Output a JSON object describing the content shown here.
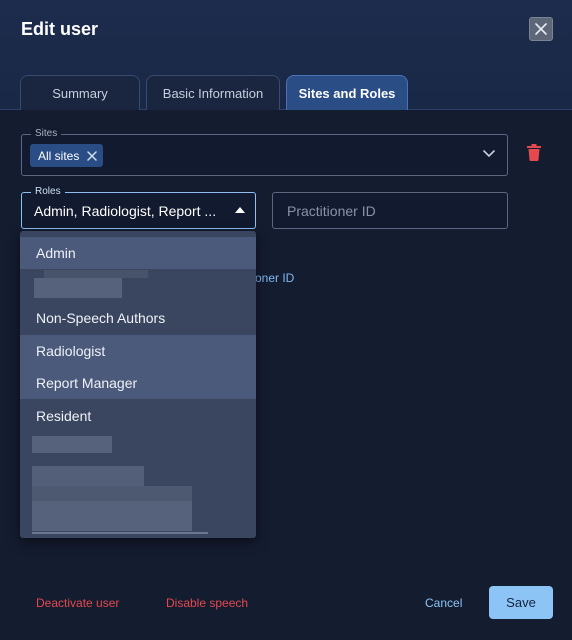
{
  "dialog": {
    "title": "Edit user"
  },
  "tabs": [
    {
      "label": "Summary",
      "active": false
    },
    {
      "label": "Basic Information",
      "active": false
    },
    {
      "label": "Sites and Roles",
      "active": true
    }
  ],
  "sites": {
    "legend": "Sites",
    "chip_label": "All sites"
  },
  "roles": {
    "legend": "Roles",
    "value": "Admin, Radiologist, Report ...",
    "options": [
      {
        "label": "Admin",
        "selected": true
      },
      {
        "label": "",
        "selected": false,
        "redacted": true
      },
      {
        "label": "Non-Speech Authors",
        "selected": false
      },
      {
        "label": "Radiologist",
        "selected": true
      },
      {
        "label": "Report Manager",
        "selected": true
      },
      {
        "label": "Resident",
        "selected": false
      }
    ]
  },
  "practitioner": {
    "placeholder": "Practitioner ID",
    "link_partial": "oner ID"
  },
  "footer": {
    "deactivate_label": "Deactivate user",
    "disable_speech_label": "Disable speech",
    "cancel_label": "Cancel",
    "save_label": "Save"
  },
  "colors": {
    "accent": "#8cc4f5",
    "danger": "#e5484d",
    "active_tab": "#2a4d86"
  }
}
